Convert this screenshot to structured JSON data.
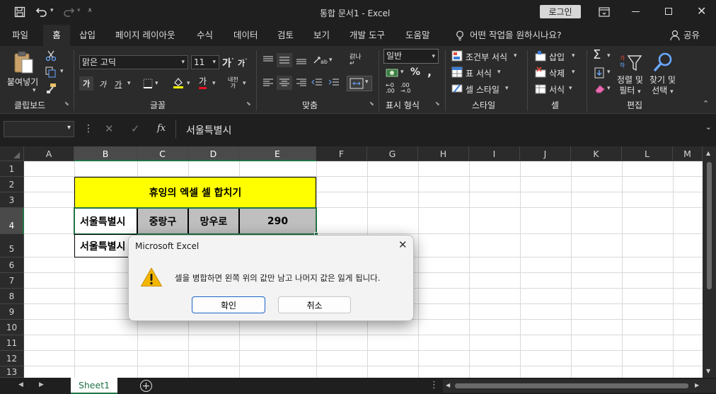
{
  "window": {
    "title": "통합 문서1  -  Excel",
    "login_label": "로그인"
  },
  "ribbon_tabs": [
    "파일",
    "홈",
    "삽입",
    "페이지 레이아웃",
    "수식",
    "데이터",
    "검토",
    "보기",
    "개발 도구",
    "도움말"
  ],
  "tell_me": "어떤 작업을 원하시나요?",
  "share_label": "공유",
  "ribbon": {
    "clipboard": {
      "paste": "붙여넣기",
      "label": "클립보드"
    },
    "font": {
      "name": "맑은 고딕",
      "size": "11",
      "label": "글꼴"
    },
    "alignment": {
      "label": "맞춤"
    },
    "number": {
      "format": "일반",
      "label": "표시 형식"
    },
    "styles": {
      "conditional": "조건부 서식",
      "table": "표 서식",
      "cell": "셀 스타일",
      "label": "스타일"
    },
    "cells": {
      "insert": "삽입",
      "delete": "삭제",
      "format": "서식",
      "label": "셀"
    },
    "editing": {
      "sort_line1": "정렬 및",
      "sort_line2": "필터",
      "find_line1": "찾기 및",
      "find_line2": "선택",
      "label": "편집"
    }
  },
  "formula_bar": {
    "name_box": "",
    "fx": "fx",
    "content": "서울특별시"
  },
  "columns": [
    "A",
    "B",
    "C",
    "D",
    "E",
    "F",
    "G",
    "H",
    "I",
    "J",
    "K",
    "L",
    "M"
  ],
  "rows": [
    "1",
    "2",
    "3",
    "4",
    "5",
    "6",
    "7",
    "8",
    "9",
    "10",
    "11",
    "12",
    "13"
  ],
  "cells": {
    "title": "휴잉의 엑셀 셀 합치기",
    "r4_b": "서울특별시",
    "r4_c": "중랑구",
    "r4_d": "망우로",
    "r4_e": "290",
    "r5_b": "서울특별시"
  },
  "sheets": [
    "Sheet1"
  ],
  "dialog": {
    "title": "Microsoft Excel",
    "message": "셀을 병합하면 왼쪽 위의 값만 남고 나머지 값은 잃게 됩니다.",
    "ok": "확인",
    "cancel": "취소"
  },
  "colors": {
    "title_fill": "#ffff00",
    "row4_fill": "#bfbfbf",
    "accent": "#217346",
    "warning": "#f2b600"
  }
}
